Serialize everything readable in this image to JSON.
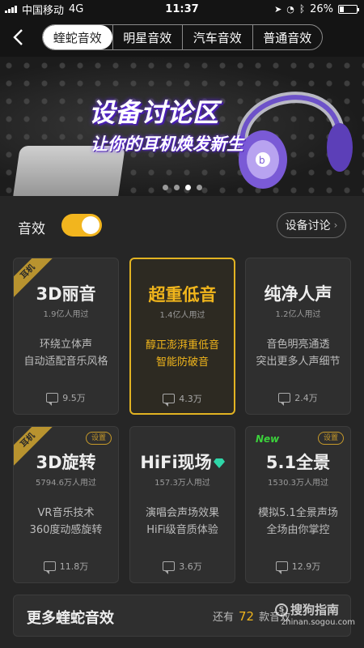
{
  "status_bar": {
    "carrier": "中国移动",
    "network": "4G",
    "time": "11:37",
    "battery": "26%"
  },
  "nav": {
    "tabs": [
      {
        "label": "蝰蛇音效",
        "active": true
      },
      {
        "label": "明星音效",
        "active": false
      },
      {
        "label": "汽车音效",
        "active": false
      },
      {
        "label": "普通音效",
        "active": false
      }
    ]
  },
  "banner": {
    "title": "设备讨论区",
    "subtitle": "让你的耳机焕发新生",
    "dots_total": 4,
    "dots_active_index": 2,
    "accent_color": "#6b2fff"
  },
  "effect": {
    "label": "音效",
    "enabled": true,
    "device_button": "设备讨论"
  },
  "cards": [
    {
      "title": "3D丽音",
      "users": "1.9亿人用过",
      "desc": [
        "环绕立体声",
        "自动适配音乐风格"
      ],
      "count": "9.5万",
      "ribbon": "耳机"
    },
    {
      "title": "超重低音",
      "users": "1.4亿人用过",
      "desc": [
        "醇正澎湃重低音",
        "智能防破音"
      ],
      "count": "4.3万",
      "selected": true
    },
    {
      "title": "纯净人声",
      "users": "1.2亿人用过",
      "desc": [
        "音色明亮通透",
        "突出更多人声细节"
      ],
      "count": "2.4万"
    },
    {
      "title": "3D旋转",
      "users": "5794.6万人用过",
      "desc": [
        "VR音乐技术",
        "360度动感旋转"
      ],
      "count": "11.8万",
      "ribbon": "耳机",
      "badge": "设置"
    },
    {
      "title": "HiFi现场",
      "users": "157.3万人用过",
      "desc": [
        "演唱会声场效果",
        "HiFi级音质体验"
      ],
      "count": "3.6万"
    },
    {
      "title": "5.1全景",
      "users": "1530.3万人用过",
      "desc": [
        "模拟5.1全景声场",
        "全场由你掌控"
      ],
      "count": "12.9万",
      "new": "New",
      "badge": "设置"
    }
  ],
  "more": {
    "title": "更多蝰蛇音效",
    "prefix": "还有",
    "count": "72",
    "suffix": "款音效"
  },
  "watermark": {
    "brand": "搜狗指南",
    "domain": "zhinan.sogou.com"
  },
  "colors": {
    "accent": "#f0b51c",
    "new_badge": "#3bd23b",
    "diamond": "#2fd6a8"
  }
}
